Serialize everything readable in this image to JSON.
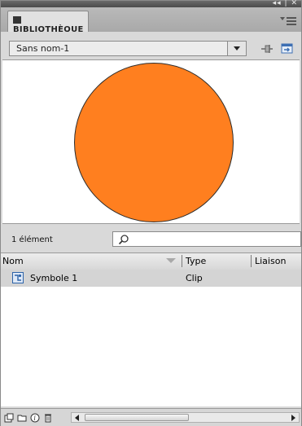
{
  "panel": {
    "tab_title": "BIBLIOTHÈQUE",
    "collapse_label": "◂◂ | ✕"
  },
  "library": {
    "document": "Sans nom-1"
  },
  "preview": {
    "fill_color": "#ff7f1f",
    "stroke_color": "#2b2b2b"
  },
  "search": {
    "count_label": "1 élément",
    "value": ""
  },
  "columns": {
    "name": "Nom",
    "type": "Type",
    "linkage": "Liaison"
  },
  "items": [
    {
      "name": "Symbole 1",
      "type": "Clip",
      "icon": "movieclip-symbol-icon"
    }
  ],
  "bottom_icons": [
    "new-symbol-icon",
    "new-folder-icon",
    "properties-icon",
    "delete-icon"
  ]
}
